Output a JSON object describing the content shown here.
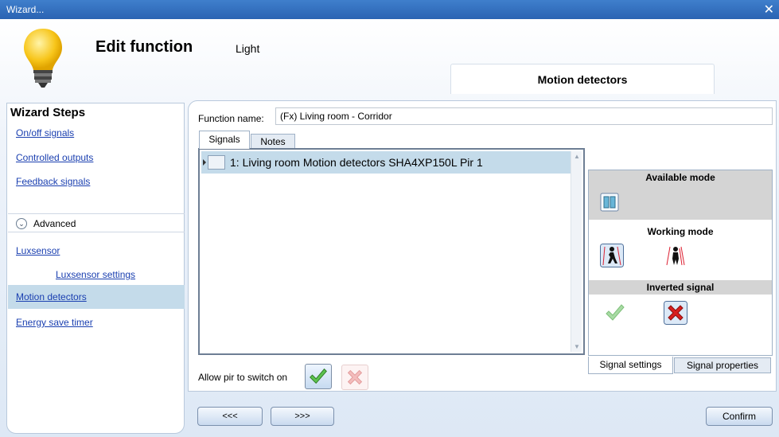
{
  "window": {
    "title": "Wizard...",
    "close_glyph": "✕"
  },
  "header": {
    "title": "Edit function",
    "subtitle": "Light",
    "current_step_tab": "Motion detectors"
  },
  "wizard_steps": {
    "title": "Wizard Steps",
    "items": [
      {
        "label": "On/off signals",
        "active": false
      },
      {
        "label": "Controlled outputs",
        "active": false
      },
      {
        "label": "Feedback signals",
        "active": false
      },
      {
        "label": "Luxsensor",
        "active": false
      },
      {
        "label": "Luxsensor settings",
        "active": false
      },
      {
        "label": "Motion detectors",
        "active": true
      },
      {
        "label": "Energy save timer",
        "active": false
      }
    ],
    "advanced_label": "Advanced",
    "advanced_icon": "chevron-down-icon"
  },
  "function_name": {
    "label": "Function name:",
    "value": "(Fx) Living room - Corridor"
  },
  "tabs": {
    "signals": "Signals",
    "notes": "Notes"
  },
  "signals": [
    {
      "label": "1: Living room Motion detectors SHA4XP150L Pir 1"
    }
  ],
  "signal_settings": {
    "available_mode_title": "Available mode",
    "working_mode_title": "Working mode",
    "inverted_signal_title": "Inverted signal"
  },
  "settings_tabs": {
    "signal_settings": "Signal settings",
    "signal_properties": "Signal properties"
  },
  "allow_pir": {
    "label": "Allow pir to switch on",
    "selected": "yes"
  },
  "nav": {
    "prev": "<<<",
    "next": ">>>",
    "confirm": "Confirm"
  },
  "colors": {
    "titlebar": "#2f6fc0",
    "active_step": "#c4dbea",
    "link": "#1a3fb0"
  }
}
